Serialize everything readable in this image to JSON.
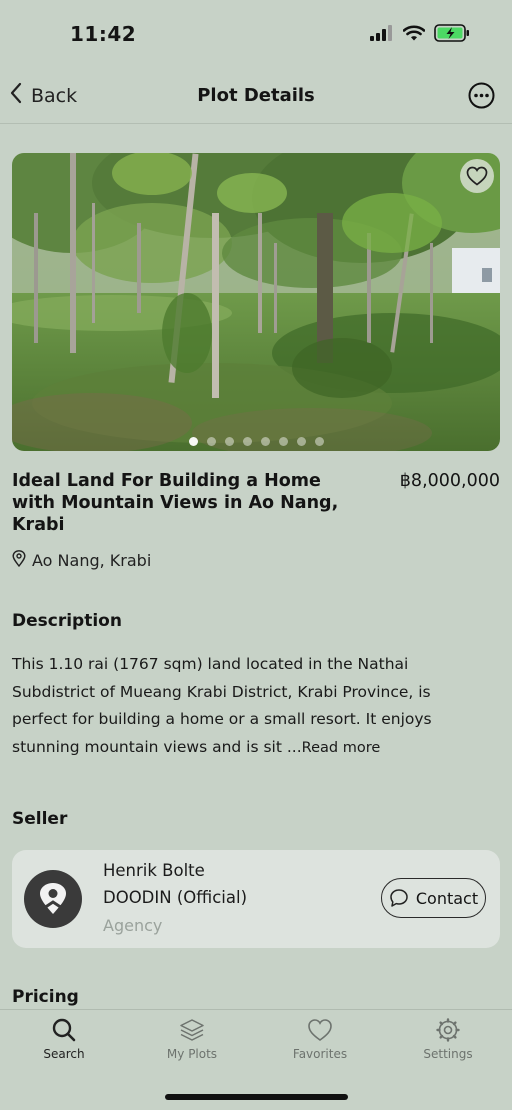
{
  "status_bar": {
    "time": "11:42",
    "icons": [
      "cellular-signal-icon",
      "wifi-icon",
      "battery-charging-icon"
    ]
  },
  "nav": {
    "back_label": "Back",
    "title": "Plot Details",
    "more_icon": "more-horizontal-icon"
  },
  "gallery": {
    "image_count": 8,
    "active_index": 0,
    "favorite_icon": "heart-icon"
  },
  "listing": {
    "title": "Ideal Land For Building a Home with Mountain Views in Ao Nang, Krabi",
    "price": "฿8,000,000",
    "location": "Ao Nang, Krabi"
  },
  "description": {
    "heading": "Description",
    "text": "This 1.10 rai (1767 sqm) land located in the Nathai Subdistrict of Mueang Krabi District, Krabi Province, is perfect for building a home or a small resort. It enjoys stunning mountain views and is sit ...",
    "read_more": "Read more"
  },
  "seller": {
    "heading": "Seller",
    "name": "Henrik Bolte",
    "company": "DOODIN (Official)",
    "type": "Agency",
    "contact_label": "Contact"
  },
  "pricing": {
    "heading": "Pricing"
  },
  "tabs": [
    {
      "label": "Search",
      "icon": "search-icon",
      "active": true
    },
    {
      "label": "My Plots",
      "icon": "layers-icon",
      "active": false
    },
    {
      "label": "Favorites",
      "icon": "heart-icon",
      "active": false
    },
    {
      "label": "Settings",
      "icon": "gear-icon",
      "active": false
    }
  ],
  "colors": {
    "background": "#c7d2c7",
    "card": "#dde3de",
    "text": "#141414",
    "muted": "#9aa29c"
  }
}
